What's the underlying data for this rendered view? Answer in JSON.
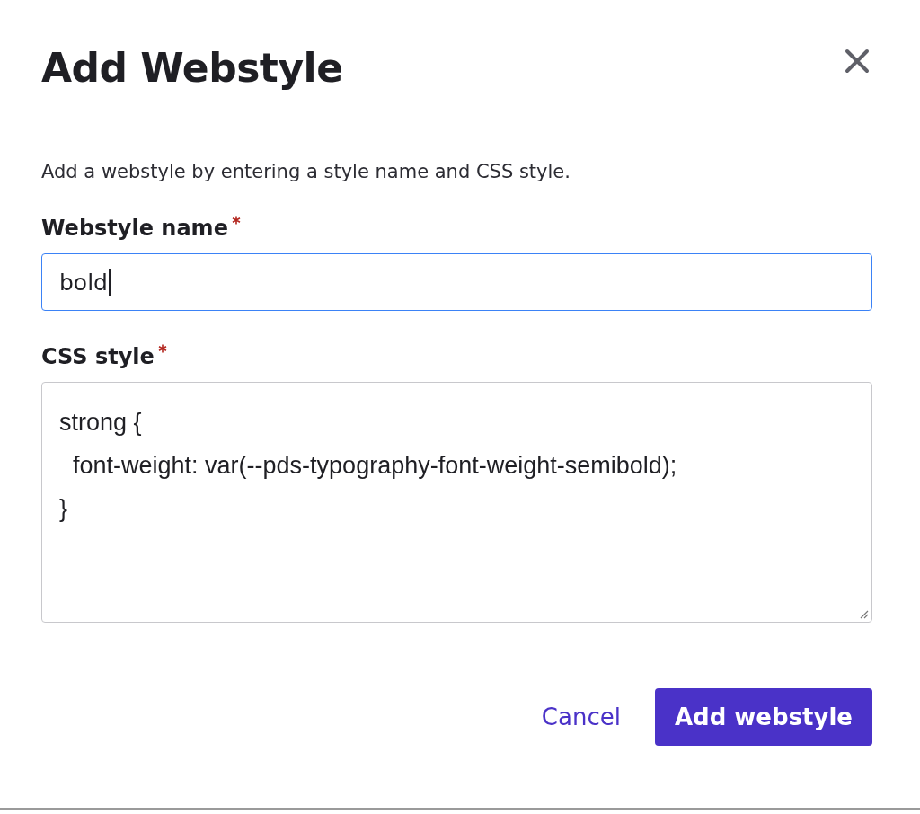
{
  "dialog": {
    "title": "Add Webstyle",
    "description": "Add a webstyle by entering a style name and CSS style.",
    "fields": [
      {
        "kind": "input",
        "label": "Webstyle name",
        "required": true,
        "focused": true,
        "value": "bold"
      },
      {
        "kind": "textarea",
        "label": "CSS style",
        "required": true,
        "focused": false,
        "value": "strong {\n  font-weight: var(--pds-typography-font-weight-semibold);\n}"
      }
    ],
    "buttons": [
      {
        "kind": "link",
        "label": "Cancel"
      },
      {
        "kind": "primary",
        "label": "Add webstyle"
      }
    ]
  }
}
